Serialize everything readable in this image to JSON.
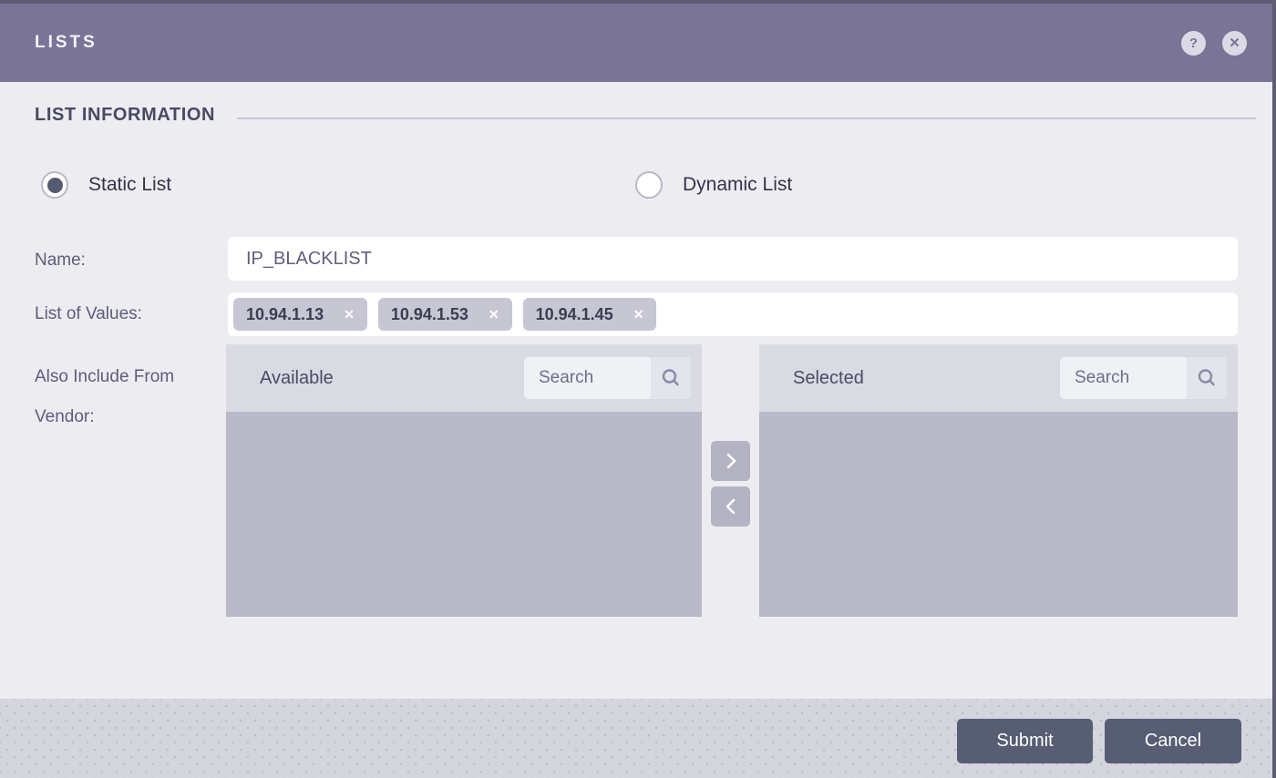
{
  "dialog": {
    "title": "LISTS"
  },
  "titlebar_icons": {
    "help_glyph": "?",
    "close_glyph": "✕"
  },
  "section": {
    "title": "LIST INFORMATION"
  },
  "list_type": {
    "options": [
      {
        "label": "Static List",
        "selected": true
      },
      {
        "label": "Dynamic List",
        "selected": false
      }
    ]
  },
  "fields": {
    "name": {
      "label": "Name:",
      "value": "IP_BLACKLIST"
    },
    "values": {
      "label": "List of Values:",
      "chips": [
        "10.94.1.13",
        "10.94.1.53",
        "10.94.1.45"
      ],
      "chip_close_glyph": "✕"
    },
    "vendor": {
      "label_line1": "Also Include From",
      "label_line2": "Vendor:"
    }
  },
  "panels": {
    "available": {
      "title": "Available",
      "search_placeholder": "Search",
      "items": []
    },
    "selected": {
      "title": "Selected",
      "search_placeholder": "Search",
      "items": []
    }
  },
  "footer": {
    "submit_label": "Submit",
    "cancel_label": "Cancel"
  },
  "colors": {
    "header_purple": "#7A7496",
    "frame_edge": "#5E5C70",
    "body_bg": "#ECECF1",
    "panel_body": "#B9B9C7",
    "chip_bg": "#C7C7D3",
    "button_bg": "#575D73",
    "footer_bg": "#D5D5DD"
  }
}
